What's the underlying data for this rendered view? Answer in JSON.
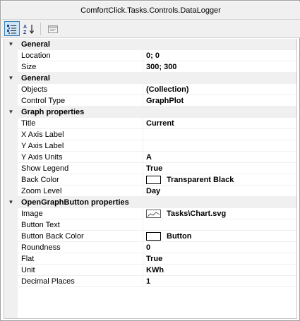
{
  "window": {
    "title": "ComfortClick.Tasks.Controls.DataLogger"
  },
  "toolbar": {
    "categorized_icon": "categorized-icon",
    "alphabetical_icon": "sort-alphabetical-icon",
    "property_pages_icon": "property-pages-icon"
  },
  "categories": [
    {
      "label": "General",
      "properties": [
        {
          "name": "Location",
          "value": "0; 0"
        },
        {
          "name": "Size",
          "value": "300; 300"
        }
      ]
    },
    {
      "label": "General",
      "properties": [
        {
          "name": "Objects",
          "value": "(Collection)"
        },
        {
          "name": "Control Type",
          "value": "GraphPlot"
        }
      ]
    },
    {
      "label": "Graph properties",
      "properties": [
        {
          "name": "Title",
          "value": "Current"
        },
        {
          "name": "X Axis Label",
          "value": ""
        },
        {
          "name": "Y Axis Label",
          "value": ""
        },
        {
          "name": "Y Axis Units",
          "value": "A"
        },
        {
          "name": "Show Legend",
          "value": "True"
        },
        {
          "name": "Back Color",
          "value": "Transparent Black",
          "swatch": "#ffffff"
        },
        {
          "name": "Zoom Level",
          "value": "Day"
        }
      ]
    },
    {
      "label": "OpenGraphButton properties",
      "properties": [
        {
          "name": "Image",
          "value": "Tasks\\Chart.svg",
          "icon": "chart-image-icon"
        },
        {
          "name": "Button Text",
          "value": ""
        },
        {
          "name": "Button Back Color",
          "value": "Button",
          "swatch": "#ffffff"
        },
        {
          "name": "Roundness",
          "value": "0"
        },
        {
          "name": "Flat",
          "value": "True"
        },
        {
          "name": "Unit",
          "value": "KWh"
        },
        {
          "name": "Decimal Places",
          "value": "1"
        }
      ]
    }
  ]
}
